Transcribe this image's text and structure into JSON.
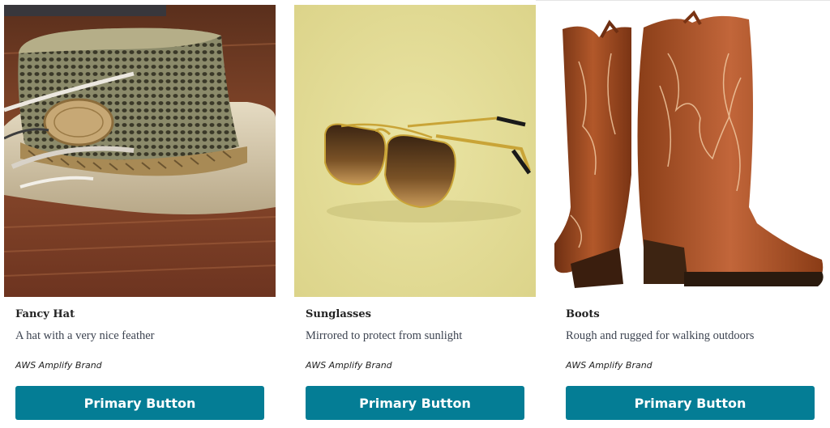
{
  "products": [
    {
      "title": "Fancy Hat",
      "description": "A hat with a very nice feather",
      "brand": "AWS Amplify Brand",
      "button_label": "Primary Button",
      "image_subject": "straw-hat-photo"
    },
    {
      "title": "Sunglasses",
      "description": "Mirrored to protect from sunlight",
      "brand": "AWS Amplify Brand",
      "button_label": "Primary Button",
      "image_subject": "sunglasses-photo"
    },
    {
      "title": "Boots",
      "description": "Rough and rugged for walking outdoors",
      "brand": "AWS Amplify Brand",
      "button_label": "Primary Button",
      "image_subject": "cowboy-boots-photo"
    }
  ],
  "colors": {
    "button_bg": "#047d95",
    "button_text": "#ffffff",
    "title_text": "#222222",
    "description_text": "#3d4451"
  }
}
